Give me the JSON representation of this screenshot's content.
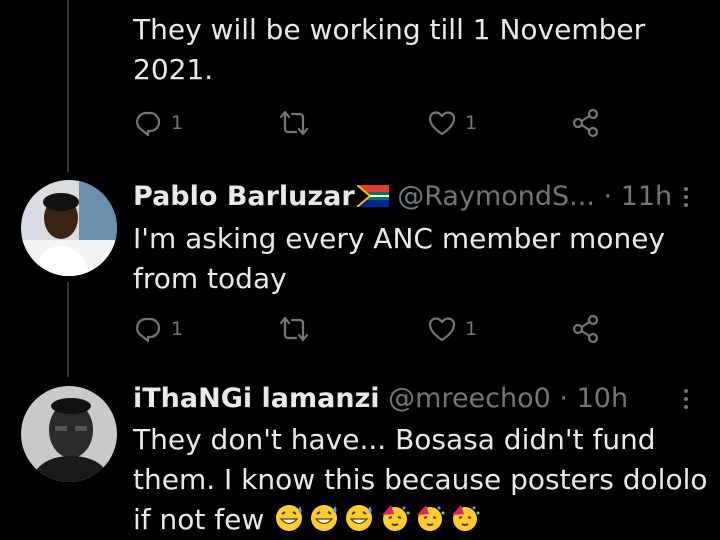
{
  "tweets": [
    {
      "text": "They will be working till 1 November 2021.",
      "replies": "1",
      "retweets": "",
      "likes": "1"
    },
    {
      "name": "Pablo Barluzar",
      "handle": "@RaymondS...",
      "dot": "·",
      "time": "11h",
      "text": "I'm asking every ANC member money from today",
      "replies": "1",
      "retweets": "",
      "likes": "1"
    },
    {
      "name": "iThaNGi lamanzi",
      "handle": "@mreecho0",
      "dot": "·",
      "time": "10h",
      "text": "They don't have... Bosasa didn't fund them. I know this because posters dololo if not few",
      "emojis": [
        "grinning-sweat-emoji",
        "grinning-sweat-emoji",
        "grinning-sweat-emoji",
        "party-face-emoji",
        "party-face-emoji",
        "party-face-emoji"
      ]
    }
  ],
  "colors": {
    "background": "#000000",
    "text": "#e7e9ea",
    "muted": "#71767b",
    "line": "#333639"
  }
}
